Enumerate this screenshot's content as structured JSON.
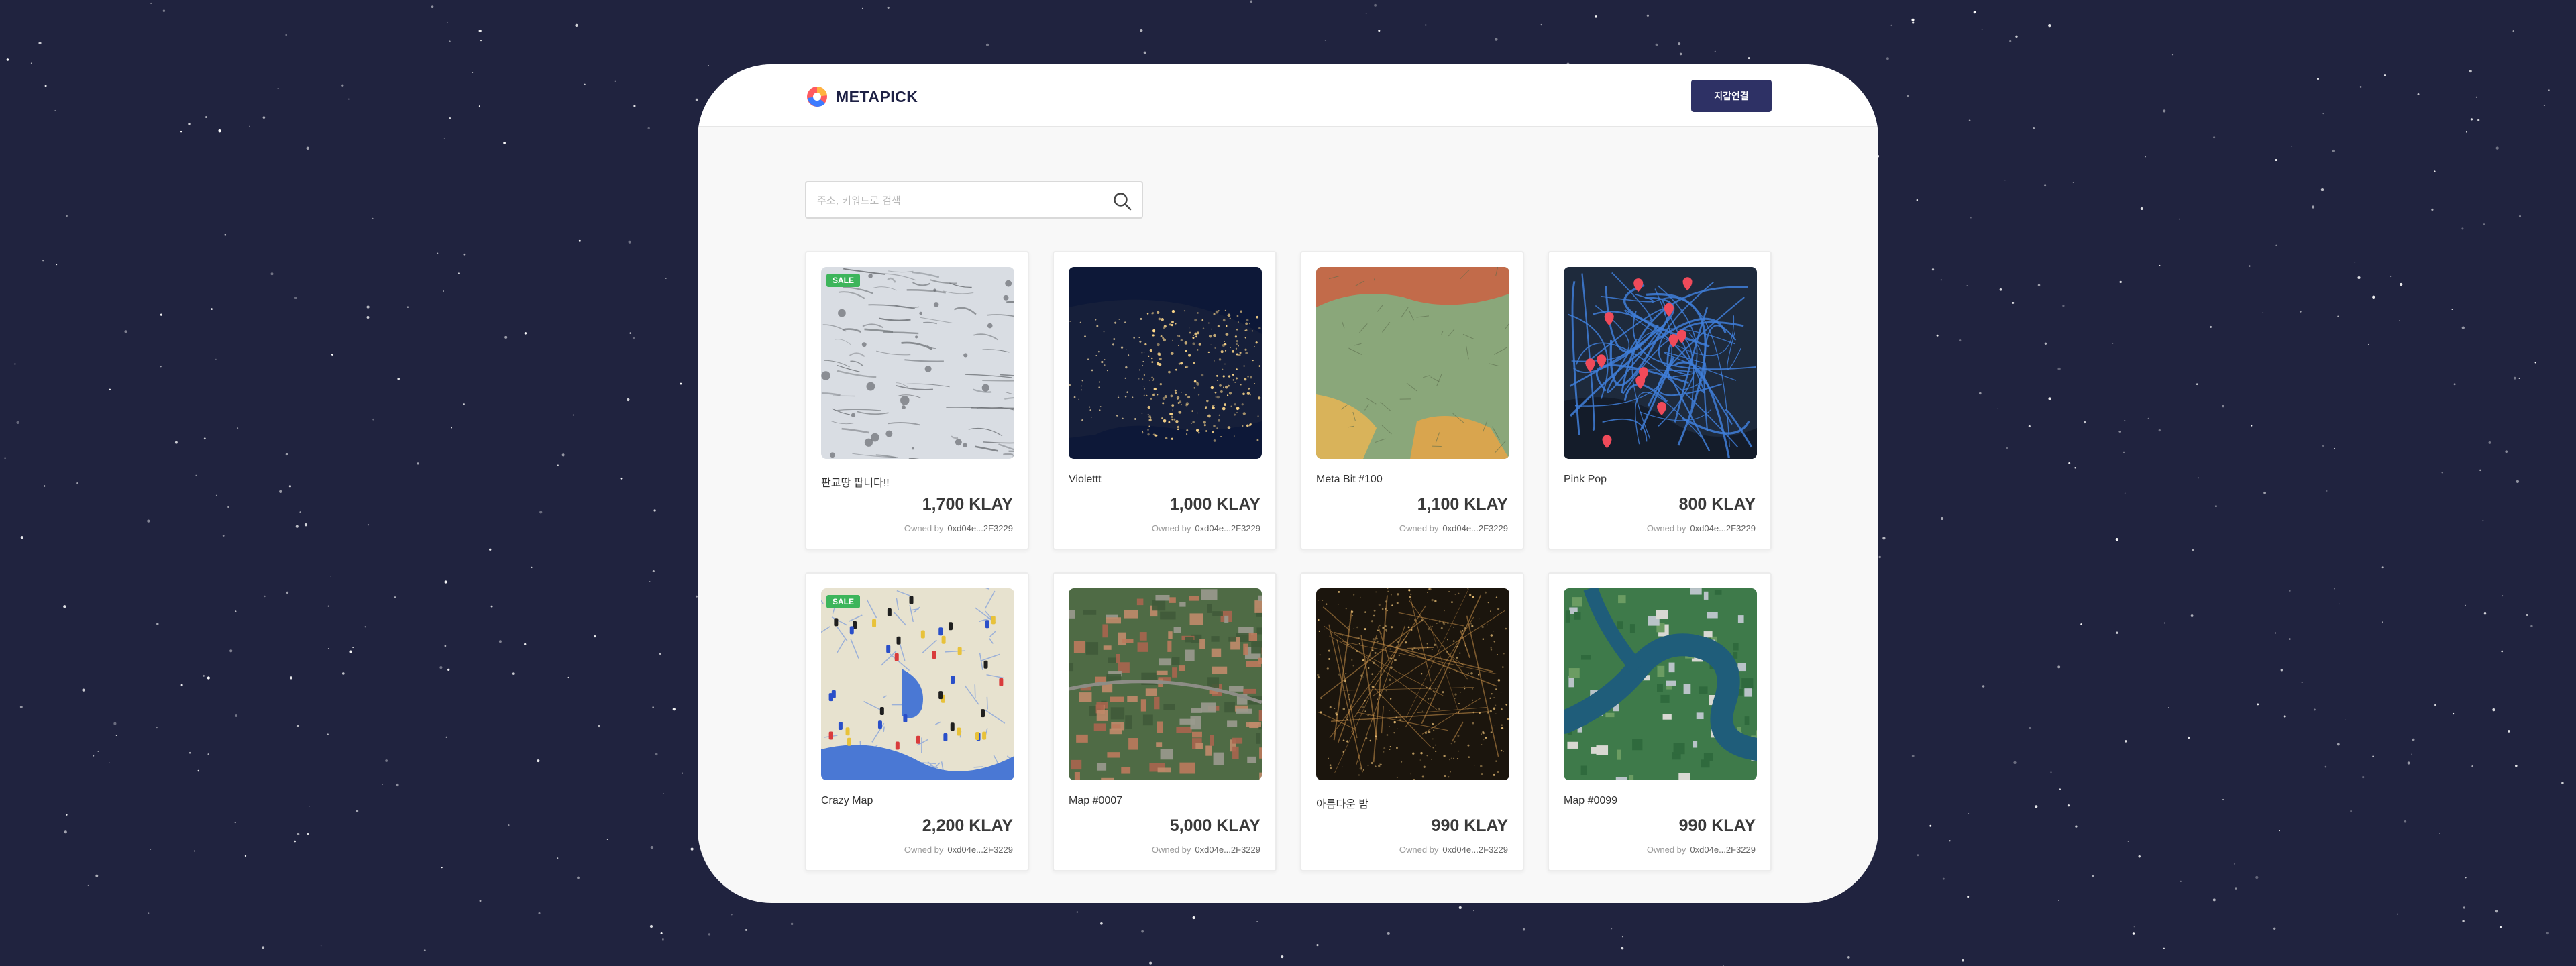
{
  "brand": {
    "name": "METAPICK"
  },
  "header": {
    "connect_label": "지갑연결"
  },
  "search": {
    "placeholder": "주소, 키워드로 검색"
  },
  "owner_label": "Owned by",
  "colors": {
    "background": "#20233f",
    "primary_button": "#2e3165",
    "sale_badge": "#3db55b"
  },
  "cards": [
    {
      "name": "판교땅 팝니다!!",
      "price": "1,700 KLAY",
      "owner": "0xd04e...2F3229",
      "badge": "SALE",
      "image": "snowy-terrain-map"
    },
    {
      "name": "Violettt",
      "price": "1,000 KLAY",
      "owner": "0xd04e...2F3229",
      "badge": "",
      "image": "night-lights-map"
    },
    {
      "name": "Meta Bit #100",
      "price": "1,100 KLAY",
      "owner": "0xd04e...2F3229",
      "badge": "",
      "image": "china-atlas-map"
    },
    {
      "name": "Pink Pop",
      "price": "800 KLAY",
      "owner": "0xd04e...2F3229",
      "badge": "",
      "image": "pink-pin-road-map"
    },
    {
      "name": "Crazy Map",
      "price": "2,200 KLAY",
      "owner": "0xd04e...2F3229",
      "badge": "SALE",
      "image": "pinned-paper-map"
    },
    {
      "name": "Map #0007",
      "price": "5,000 KLAY",
      "owner": "0xd04e...2F3229",
      "badge": "",
      "image": "aerial-town-map"
    },
    {
      "name": "아름다운 밤",
      "price": "990 KLAY",
      "owner": "0xd04e...2F3229",
      "badge": "",
      "image": "night-city-aerial"
    },
    {
      "name": "Map #0099",
      "price": "990 KLAY",
      "owner": "0xd04e...2F3229",
      "badge": "",
      "image": "river-neighborhood-aerial"
    }
  ]
}
